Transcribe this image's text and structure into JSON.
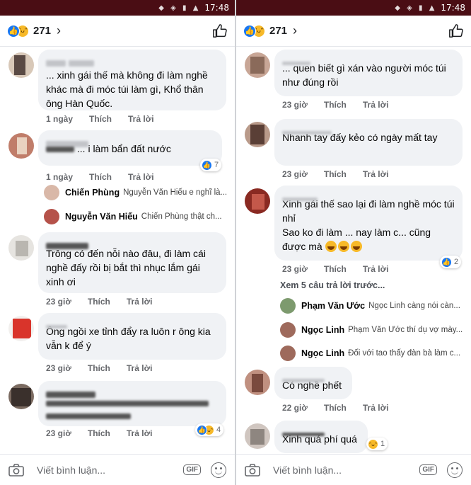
{
  "status": {
    "time": "17:48"
  },
  "left": {
    "reaction_count": "271",
    "comments": [
      {
        "text": "... xinh gái thế mà không đi làm nghề khác mà đi móc túi làm gì, Khổ thân ông Hàn Quốc.",
        "time": "1 ngày",
        "like": "Thích",
        "reply": "Trả lời"
      },
      {
        "text": "... i làm bẩn đất nước",
        "time": "1 ngày",
        "like": "Thích",
        "reply": "Trả lời",
        "reactions": "7"
      },
      {
        "text": "Trông có đến nỗi nào đâu, đi làm cái nghề đấy rồi bị bắt thì nhục lắm gái xinh ơi",
        "time": "23 giờ",
        "like": "Thích",
        "reply": "Trả lời"
      },
      {
        "text": "Ông ngồi xe tỉnh đẩy ra luôn r ông kia vẫn k để ý",
        "time": "23 giờ",
        "like": "Thích",
        "reply": "Trả lời"
      },
      {
        "text": "",
        "time": "23 giờ",
        "like": "Thích",
        "reply": "Trả lời",
        "reactions": "4"
      }
    ],
    "replies": [
      {
        "name": "Chiến Phùng",
        "text": "Nguyễn Văn Hiếu e nghĩ là..."
      },
      {
        "name": "Nguyễn Văn Hiếu",
        "text": "Chiến Phùng thật ch..."
      }
    ],
    "composer": {
      "placeholder": "Viết bình luận...",
      "gif": "GIF"
    }
  },
  "right": {
    "reaction_count": "271",
    "comments": [
      {
        "text": "... quen biết gì xán vào người móc túi như đúng rồi",
        "time": "23 giờ",
        "like": "Thích",
        "reply": "Trả lời"
      },
      {
        "text": "Nhanh tay đấy kẻo có ngày mất tay",
        "time": "23 giờ",
        "like": "Thích",
        "reply": "Trả lời"
      },
      {
        "text1": "Xinh gái thế sao lại đi làm nghề móc túi nhỉ",
        "text2": "Sao ko đi làm ... nay làm c... cũng được mà",
        "time": "23 giờ",
        "like": "Thích",
        "reply": "Trả lời",
        "reactions": "2"
      },
      {
        "text": "Có nghề phết",
        "time": "22 giờ",
        "like": "Thích",
        "reply": "Trả lời"
      },
      {
        "text": "Xinh quá phí quá",
        "reactions": "1"
      }
    ],
    "more_replies": "Xem 5 câu trả lời trước...",
    "replies": [
      {
        "name": "Phạm Văn Ước",
        "text": "Ngọc Linh càng nói càn..."
      },
      {
        "name": "Ngọc Linh",
        "text": "Phạm Văn Ước thí dụ vợ mày..."
      },
      {
        "name": "Ngọc Linh",
        "text": "Đối với tao thấy đàn bà làm c..."
      }
    ],
    "composer": {
      "placeholder": "Viết bình luận...",
      "gif": "GIF"
    }
  },
  "colors": {
    "accent": "#1877f2",
    "bubble": "#f0f2f5",
    "meta": "#65676b"
  }
}
